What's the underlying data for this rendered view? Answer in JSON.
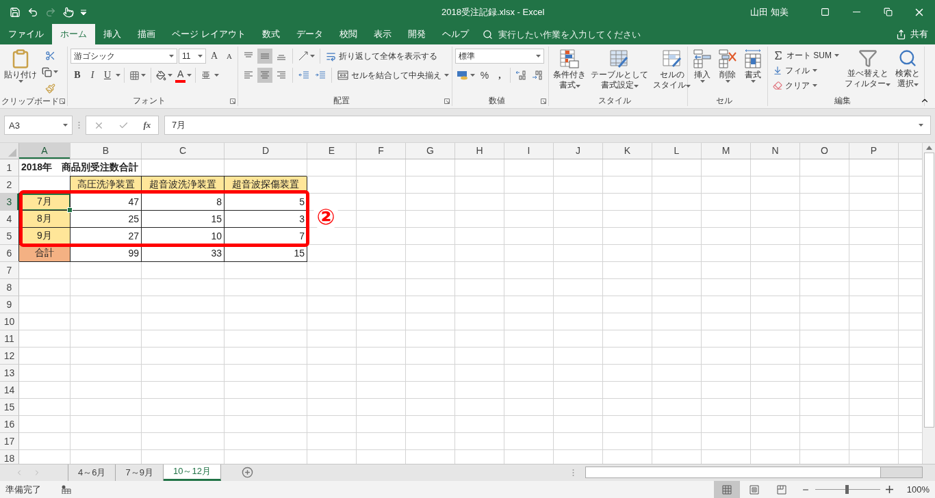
{
  "title_bar": {
    "title": "2018受注記録.xlsx  -  Excel",
    "user": "山田 知美"
  },
  "menu_tabs": [
    {
      "label": "ファイル",
      "selected": false
    },
    {
      "label": "ホーム",
      "selected": true
    },
    {
      "label": "挿入",
      "selected": false
    },
    {
      "label": "描画",
      "selected": false
    },
    {
      "label": "ページ レイアウト",
      "selected": false
    },
    {
      "label": "数式",
      "selected": false
    },
    {
      "label": "データ",
      "selected": false
    },
    {
      "label": "校閲",
      "selected": false
    },
    {
      "label": "表示",
      "selected": false
    },
    {
      "label": "開発",
      "selected": false
    },
    {
      "label": "ヘルプ",
      "selected": false
    }
  ],
  "tell_me": {
    "placeholder": "実行したい作業を入力してください"
  },
  "share": "共有",
  "ribbon": {
    "clipboard": {
      "title": "クリップボード",
      "paste": "貼り付け"
    },
    "font": {
      "title": "フォント",
      "font_name": "游ゴシック",
      "font_size": "11",
      "grow": "A",
      "shrink": "A",
      "bold": "B",
      "italic": "I",
      "underline": "U",
      "font_color": "A",
      "phonetic": "亜"
    },
    "alignment": {
      "title": "配置",
      "vertical": [
        {
          "kind": "top",
          "selected": false
        },
        {
          "kind": "middle",
          "selected": true
        },
        {
          "kind": "bottom",
          "selected": false
        }
      ],
      "horizontal": [
        {
          "kind": "left",
          "selected": false
        },
        {
          "kind": "center",
          "selected": true
        },
        {
          "kind": "right",
          "selected": false
        }
      ],
      "wrap_text": "折り返して全体を表示する",
      "merge_center": "セルを結合して中央揃え"
    },
    "number": {
      "title": "数値",
      "format": "標準",
      "percent": "%",
      "comma": ","
    },
    "styles": {
      "title": "スタイル",
      "buttons": [
        {
          "kind": "conditional",
          "lines": [
            "条件付き",
            "書式"
          ]
        },
        {
          "kind": "table",
          "lines": [
            "テーブルとして",
            "書式設定"
          ]
        },
        {
          "kind": "cellstyle",
          "lines": [
            "セルの",
            "スタイル"
          ]
        }
      ]
    },
    "cells": {
      "title": "セル",
      "buttons": [
        {
          "kind": "insert",
          "label": "挿入"
        },
        {
          "kind": "delete",
          "label": "削除"
        },
        {
          "kind": "format",
          "label": "書式"
        }
      ]
    },
    "editing": {
      "title": "編集",
      "autosum": "オート SUM",
      "fill": "フィル",
      "clear": "クリア",
      "sort": [
        "並べ替えと",
        "フィルター"
      ],
      "find": [
        "検索と",
        "選択"
      ]
    }
  },
  "formula_bar": {
    "name_box": "A3",
    "function_label": "fx",
    "formula": "7月"
  },
  "sheet": {
    "columns": [
      {
        "label": "A",
        "selected": true
      },
      {
        "label": "B",
        "selected": false
      },
      {
        "label": "C",
        "selected": false
      },
      {
        "label": "D",
        "selected": false
      },
      {
        "label": "E",
        "selected": false
      },
      {
        "label": "F",
        "selected": false
      },
      {
        "label": "G",
        "selected": false
      },
      {
        "label": "H",
        "selected": false
      },
      {
        "label": "I",
        "selected": false
      },
      {
        "label": "J",
        "selected": false
      },
      {
        "label": "K",
        "selected": false
      },
      {
        "label": "L",
        "selected": false
      },
      {
        "label": "M",
        "selected": false
      },
      {
        "label": "N",
        "selected": false
      },
      {
        "label": "O",
        "selected": false
      },
      {
        "label": "P",
        "selected": false
      }
    ],
    "rows": [
      {
        "header": "1",
        "selected": false,
        "cells": [
          {
            "text": "2018年　商品別受注数合計",
            "kind": "title"
          }
        ]
      },
      {
        "header": "2",
        "selected": false,
        "cells": [
          {
            "kind": "blank"
          },
          {
            "text": "高圧洗浄装置",
            "kind": "header",
            "color": "#ffe699"
          },
          {
            "text": "超音波洗浄装置",
            "kind": "header",
            "color": "#ffe699"
          },
          {
            "text": "超音波探傷装置",
            "kind": "header",
            "color": "#ffe699"
          }
        ]
      },
      {
        "header": "3",
        "selected": true,
        "cells": [
          {
            "text": "7月",
            "kind": "label",
            "color": "#ffe699"
          },
          {
            "text": "47",
            "kind": "number"
          },
          {
            "text": "8",
            "kind": "number"
          },
          {
            "text": "5",
            "kind": "number"
          }
        ]
      },
      {
        "header": "4",
        "selected": false,
        "cells": [
          {
            "text": "8月",
            "kind": "label",
            "color": "#ffe699"
          },
          {
            "text": "25",
            "kind": "number"
          },
          {
            "text": "15",
            "kind": "number"
          },
          {
            "text": "3",
            "kind": "number"
          }
        ]
      },
      {
        "header": "5",
        "selected": false,
        "cells": [
          {
            "text": "9月",
            "kind": "label",
            "color": "#ffe699"
          },
          {
            "text": "27",
            "kind": "number"
          },
          {
            "text": "10",
            "kind": "number"
          },
          {
            "text": "7",
            "kind": "number"
          }
        ]
      },
      {
        "header": "6",
        "selected": false,
        "cells": [
          {
            "text": "合計",
            "kind": "label",
            "color": "#f4b183"
          },
          {
            "text": "99",
            "kind": "number"
          },
          {
            "text": "33",
            "kind": "number"
          },
          {
            "text": "15",
            "kind": "number"
          }
        ]
      },
      {
        "header": "7",
        "selected": false
      },
      {
        "header": "8",
        "selected": false
      },
      {
        "header": "9",
        "selected": false
      },
      {
        "header": "10",
        "selected": false
      },
      {
        "header": "11",
        "selected": false
      },
      {
        "header": "12",
        "selected": false
      },
      {
        "header": "13",
        "selected": false
      },
      {
        "header": "14",
        "selected": false
      },
      {
        "header": "15",
        "selected": false
      },
      {
        "header": "16",
        "selected": false
      },
      {
        "header": "17",
        "selected": false
      },
      {
        "header": "18",
        "selected": false
      }
    ]
  },
  "annotation": {
    "marker": "②"
  },
  "sheet_tabs": [
    {
      "label": "4～6月",
      "selected": false
    },
    {
      "label": "7～9月",
      "selected": false
    },
    {
      "label": "10～12月",
      "selected": true
    }
  ],
  "status_bar": {
    "status": "準備完了",
    "views": [
      {
        "kind": "normal",
        "selected": true
      },
      {
        "kind": "page_layout",
        "selected": false
      },
      {
        "kind": "page_break",
        "selected": false
      }
    ],
    "zoom": {
      "level": 0.5,
      "reading": "100%"
    }
  }
}
